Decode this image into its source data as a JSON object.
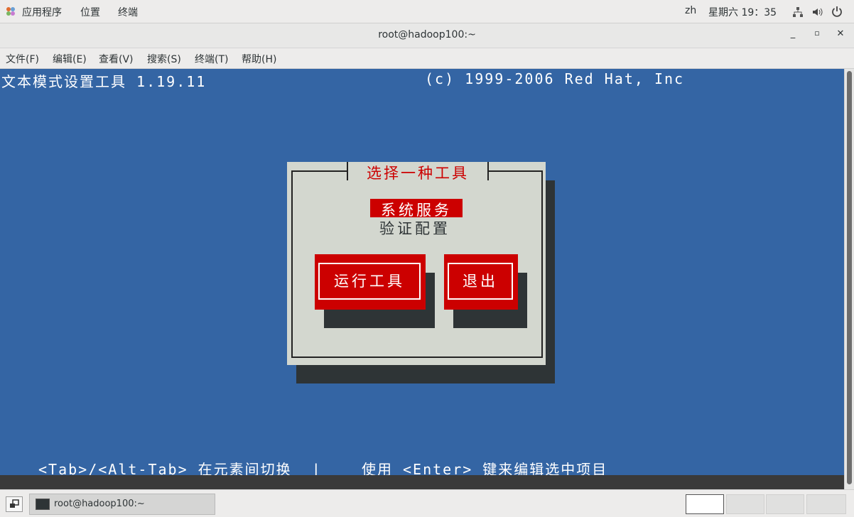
{
  "top_panel": {
    "apps": "应用程序",
    "places": "位置",
    "terminal_app": "终端",
    "lang": "zh",
    "clock": "星期六 19：35"
  },
  "window": {
    "title": "root@hadoop100:~",
    "minimize": "_",
    "maximize": "▫",
    "close": "✕"
  },
  "menubar": {
    "file": "文件(F)",
    "edit": "编辑(E)",
    "view": "查看(V)",
    "search": "搜索(S)",
    "terminal": "终端(T)",
    "help": "帮助(H)"
  },
  "terminal": {
    "header_left": "文本模式设置工具 1.19.11",
    "header_right": "(c) 1999-2006 Red Hat, Inc",
    "footer": "<Tab>/<Alt-Tab> 在元素间切换  |    使用 <Enter> 键来编辑选中项目"
  },
  "dialog": {
    "title": "选择一种工具",
    "options": [
      "系统服务",
      "验证配置"
    ],
    "selected_index": 0,
    "run_button": "运行工具",
    "quit_button": "退出"
  },
  "taskbar": {
    "task_label": "root@hadoop100:~"
  },
  "colors": {
    "terminal_bg": "#3465a4",
    "dialog_bg": "#d3d7cf",
    "accent_red": "#cc0000",
    "shadow": "#2e3436"
  }
}
